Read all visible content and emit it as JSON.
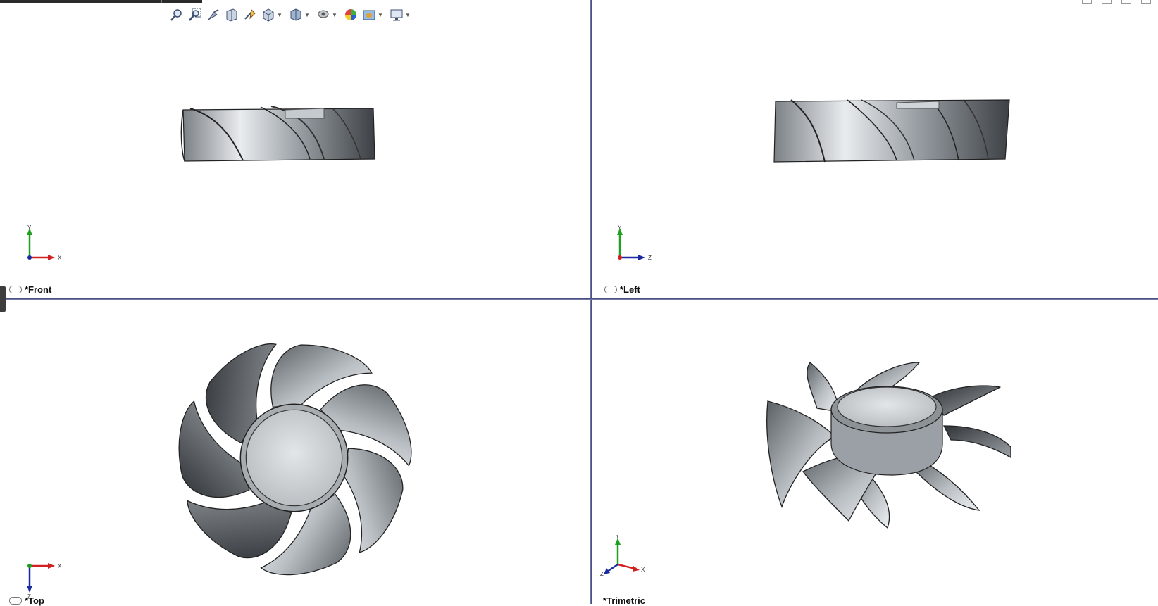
{
  "viewports": {
    "front": {
      "label": "*Front"
    },
    "left": {
      "label": "*Left"
    },
    "top": {
      "label": "*Top"
    },
    "trimetric": {
      "label": "*Trimetric"
    }
  },
  "triads": {
    "front": {
      "a": "Y",
      "b": "X"
    },
    "left": {
      "a": "Y",
      "b": "Z"
    },
    "top": {
      "a": "X",
      "b": "Z"
    },
    "trimetric": {
      "a": "Y",
      "b": "X",
      "c": "Z"
    }
  },
  "toolbar": {
    "icons": [
      "zoom-to-fit-icon",
      "zoom-to-area-icon",
      "previous-view-icon",
      "section-view-icon",
      "dynamic-annotation-icon",
      "view-orientation-icon",
      "display-style-icon",
      "hide-show-icon",
      "edit-appearance-icon",
      "apply-scene-icon",
      "view-settings-icon"
    ]
  },
  "colors": {
    "splitter": "#3e4478",
    "triad_x": "#d22020",
    "triad_y": "#20a020",
    "triad_z": "#1a2aa0",
    "model_gray": "#a9aeb3"
  }
}
